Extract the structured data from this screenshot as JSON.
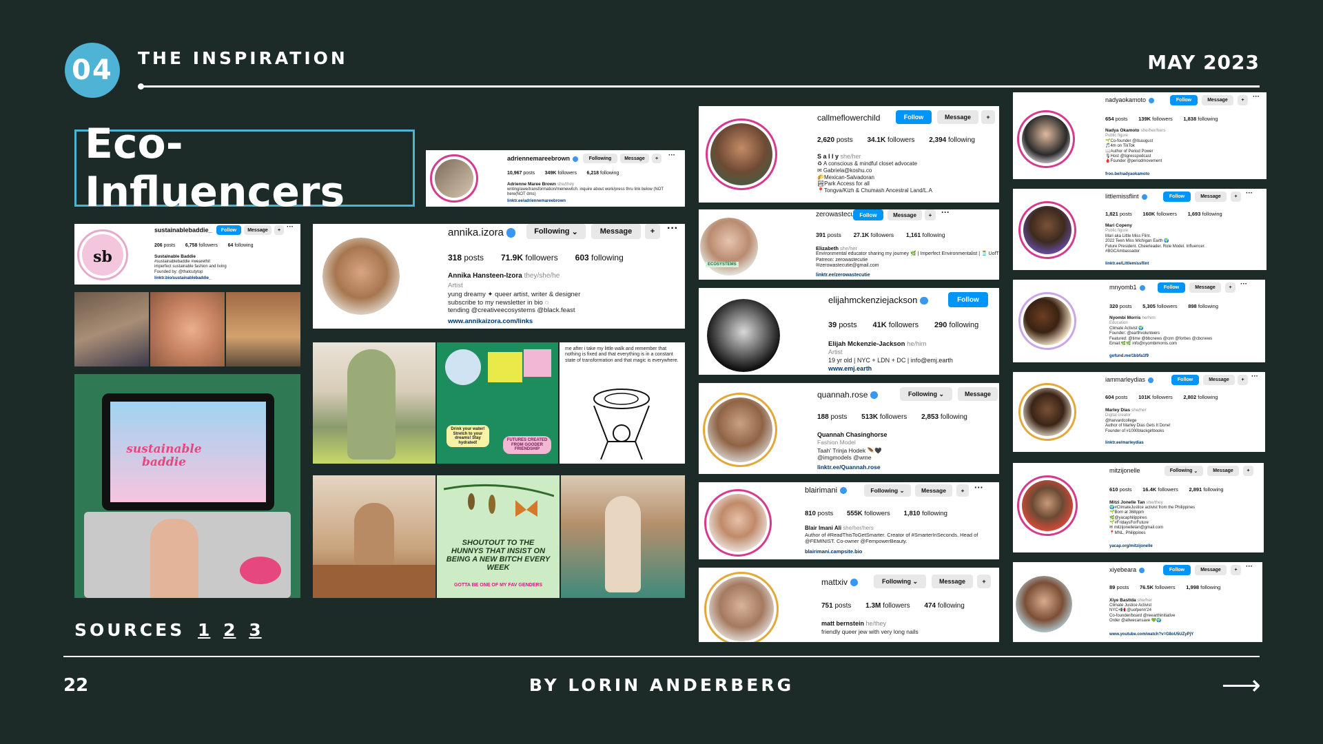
{
  "header": {
    "number": "04",
    "section_title": "THE INSPIRATION",
    "date": "MAY 2023"
  },
  "title": "Eco-Influencers",
  "footer": {
    "sources_label": "SOURCES",
    "source_links": [
      "1",
      "2",
      "3"
    ],
    "page_number": "22",
    "author": "BY LORIN ANDERBERG",
    "next_icon": "right-arrow-icon"
  },
  "profiles": {
    "adrienne": {
      "username": "adriennemareebrown",
      "following_btn": "Following",
      "message_btn": "Message",
      "posts": "10,967",
      "followers": "349K",
      "following": "6,218",
      "name": "Adrienne Maree Brown",
      "pronouns": "she/they",
      "bio": "writing/awe/transformation/memewitch. inquire about work/press thru link below (NOT\nhere(NOT dms) ",
      "link": "linktr.ee/adriennemareebrown"
    },
    "sustainable": {
      "username": "sustainablebaddie_",
      "follow_btn": "Follow",
      "message_btn": "Message",
      "posts": "206",
      "followers": "6,758",
      "following": "64",
      "name": "Sustainable Baddie",
      "bio": "#sustainablebaddie #wearethit\nimperfect sustainable fashion and living\nFounded by: @thatcutytop",
      "link": "linktr.bio/sustainablebaddie_"
    },
    "annika": {
      "username": "annika.izora",
      "following_btn": "Following",
      "message_btn": "Message",
      "posts": "318",
      "followers": "71.9K",
      "following": "603",
      "name": "Annika Hansteen-Izora",
      "pronouns": "they/she/he",
      "category": "Artist",
      "bio": "yung dreamy ✦ queer artist, writer & designer\nsubscribe to my newsletter in bio ◌\ntending @creativeecosystems @black.feast",
      "link": "www.annikaizora.com/links"
    },
    "callme": {
      "username": "callmeflowerchild",
      "follow_btn": "Follow",
      "message_btn": "Message",
      "posts": "2,620",
      "followers": "34.1K",
      "following": "2,394",
      "name": "S a l l y",
      "pronouns": "she/her",
      "bio": "♻ A conscious & mindful closet advocate\n✉ Gabriela@koshu.co\n🌮Mexican-Salvadoran\n🏞Park Access for all\n📍Tongva/Kizh & Chumash Ancestral Land/L.A"
    },
    "zero": {
      "username": "zerowastecutie",
      "follow_btn": "Follow",
      "message_btn": "Message",
      "posts": "391",
      "followers": "27.1K",
      "following": "1,161",
      "name": "Elizabeth",
      "pronouns": "she/her",
      "bio": "Environmental educator sharing my journey 🌿 | Imperfect Environmentalist | 🫙 UofT\nPatreon: zerowastecutie\n✉zerowastecutie@gmail.com",
      "link": "linktr.ee/zerowastecutie",
      "sticker": "ECOSYSTEMS"
    },
    "elijah": {
      "username": "elijahmckenziejackson",
      "follow_btn": "Follow",
      "posts": "39",
      "followers": "41K",
      "following": "290",
      "name": "Elijah Mckenzie-Jackson",
      "pronouns": "he/him",
      "category": "Artist",
      "bio": "19 yr old | NYC + LDN + DC | info@emj.earth",
      "link": "www.emj.earth"
    },
    "quannah": {
      "username": "quannah.rose",
      "following_btn": "Following",
      "message_btn": "Message",
      "posts": "188",
      "followers": "513K",
      "following": "2,853",
      "name": "Quannah Chasinghorse",
      "category": "Fashion Model",
      "bio": "Taah' Trinja Hodek 🪶🖤\n@imgmodels @wme",
      "link": "linktr.ee/Quannah.rose"
    },
    "blair": {
      "username": "blairimani",
      "following_btn": "Following",
      "message_btn": "Message",
      "posts": "810",
      "followers": "555K",
      "following": "1,810",
      "name": "Blair Imani Ali",
      "pronouns": "she/her/hers",
      "bio": "Author of #ReadThisToGetSmarter. Creator of #SmarterInSeconds. Head of\n@FEMINIST. Co-owner @FempowerBeauty.",
      "link": "blairimani.campsite.bio"
    },
    "matt": {
      "username": "mattxiv",
      "following_btn": "Following",
      "message_btn": "Message",
      "posts": "751",
      "followers": "1.3M",
      "following": "474",
      "name": "matt bernstein",
      "pronouns": "he/they",
      "bio": "friendly queer jew with very long nails"
    },
    "nadya": {
      "username": "nadyaokamoto",
      "follow_btn": "Follow",
      "message_btn": "Message",
      "posts": "654",
      "followers": "139K",
      "following": "1,838",
      "name": "Nadya Okamoto",
      "pronouns": "she/her/hers",
      "category": "Public figure",
      "bio": "🌱Co-founder @itsaugust\n🎵4m on TikTok\n📖Author of Period Power\n🎙Host @tigresspodcast\n🩸Founder @periodmovement",
      "link": "froo.be/nadyaokamoto"
    },
    "little": {
      "username": "littlemissflint",
      "follow_btn": "Follow",
      "message_btn": "Message",
      "posts": "1,821",
      "followers": "160K",
      "following": "1,693",
      "name": "Mari Copeny",
      "category": "Public figure",
      "bio": "Mari aka Little Miss Flint.\n2022 Teen Miss Michigan Earth 🌍\nFuture President. Cheerleader. Role Model. Influencer.\n#BGCAmbassador",
      "link": "linktr.ee/Littlemissflint"
    },
    "mnyomb": {
      "username": "mnyomb1",
      "follow_btn": "Follow",
      "message_btn": "Message",
      "posts": "320",
      "followers": "5,305",
      "following": "898",
      "name": "Nyombi Morris",
      "pronouns": "he/him",
      "category": "Education",
      "bio": "Climate Activist 🌍\nFounder: @earthvolunteers\nFeatured: @time @bbcnews @cnn @forbes @cbcnews\nEmail:🌿🌿 info@nyombimorris.com",
      "link": "gofund.me/1bbfa1f9"
    },
    "iamm": {
      "username": "iammarleydias",
      "follow_btn": "Follow",
      "message_btn": "Message",
      "posts": "604",
      "followers": "101K",
      "following": "2,802",
      "name": "Marley Dias",
      "pronouns": "she/her",
      "category": "Digital creator",
      "bio": "@harvardcollege\nAuthor of Marley Dias Gets It Done!\nFounder of #1000blackgirlbooks",
      "link": "linktr.ee/marleydias"
    },
    "mitzi": {
      "username": "mitzijonelle",
      "following_btn": "Following",
      "message_btn": "Message",
      "posts": "610",
      "followers": "16.4K",
      "following": "2,891",
      "name": "Mitzi Jonelle Tan",
      "pronouns": "she/they",
      "bio": "🌍#ClimateJustice activist from the Philippines\n🌱Born at 368ppm\n🌿@yacaphilippines\n🌱#FridaysForFuture\n✉ mitzijonelletan@gmail.com\n📍MNL, Philippines",
      "link": "yacap.org/mitzijonelle"
    },
    "xiye": {
      "username": "xiyebeara",
      "follow_btn": "Follow",
      "message_btn": "Message",
      "posts": "89",
      "followers": "76.5K",
      "following": "1,998",
      "name": "Xiye Bastida",
      "pronouns": "she/her",
      "bio": "Climate Justice Activist\nNYC+🇲🇽 @uofpenn'24\nCo-founder/board @reearthinitiative\nOrder @allwecansave 💚🌍",
      "link": "www.youtube.com/watch?v=G8oU5UZyPjY"
    }
  },
  "tiles": {
    "laptop_sticker": "sustainable baddie",
    "poster_cta": "Drink your water! Stretch to your dreams! Stay hydrated!",
    "poster_title": "FUTURES CREATED FROM GOODER FRIENDSHIP",
    "quote": "me after i take my little walk and remember that nothing is fixed and that everything is in a constant state of transformation and that magic is everywhere.",
    "butterfly_quote": "SHOUTOUT TO THE HUNNYS THAT INSIST ON BEING A NEW BITCH EVERY WEEK",
    "butterfly_sub": "GOTTA BE ONE OF MY FAV GENDERS"
  },
  "labels": {
    "posts": "posts",
    "followers": "followers",
    "following": "following"
  }
}
